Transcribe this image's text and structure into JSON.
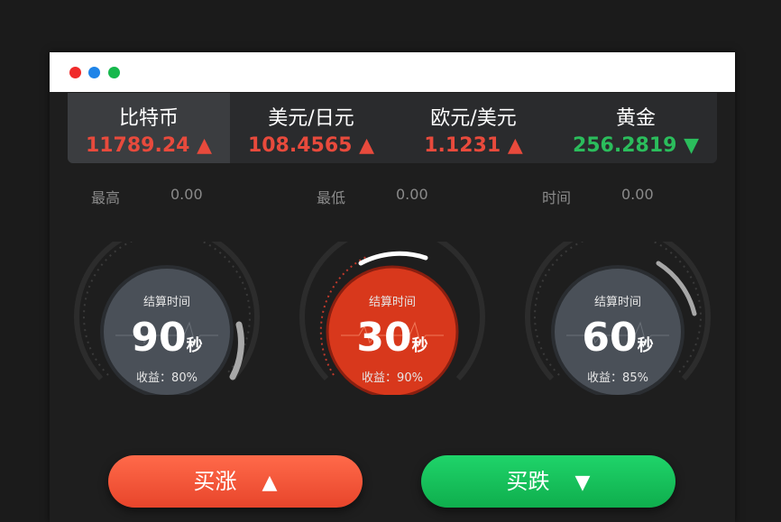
{
  "window": {
    "controls": [
      "close",
      "minimize",
      "maximize"
    ]
  },
  "ticker": [
    {
      "name": "比特币",
      "price": "11789.24",
      "trend": "up",
      "active": true
    },
    {
      "name": "美元/日元",
      "price": "108.4565",
      "trend": "up",
      "active": false
    },
    {
      "name": "欧元/美元",
      "price": "1.1231",
      "trend": "up",
      "active": false
    },
    {
      "name": "黄金",
      "price": "256.2819",
      "trend": "down",
      "active": false
    }
  ],
  "stats": [
    {
      "label": "最高",
      "value": "0.00"
    },
    {
      "label": "最低",
      "value": "0.00"
    },
    {
      "label": "时间",
      "value": "0.00"
    }
  ],
  "dials": [
    {
      "label": "结算时间",
      "number": "90",
      "unit": "秒",
      "yield": "收益：80%",
      "selected": false
    },
    {
      "label": "结算时间",
      "number": "30",
      "unit": "秒",
      "yield": "收益：90%",
      "selected": true
    },
    {
      "label": "结算时间",
      "number": "60",
      "unit": "秒",
      "yield": "收益：85%",
      "selected": false
    }
  ],
  "buttons": {
    "buy_up": "买涨",
    "buy_up_arrow": "▲",
    "buy_down": "买跌",
    "buy_down_arrow": "▼"
  },
  "colors": {
    "up": "#e84a3c",
    "down": "#2bbd5c",
    "accent_red": "#e8452b"
  }
}
